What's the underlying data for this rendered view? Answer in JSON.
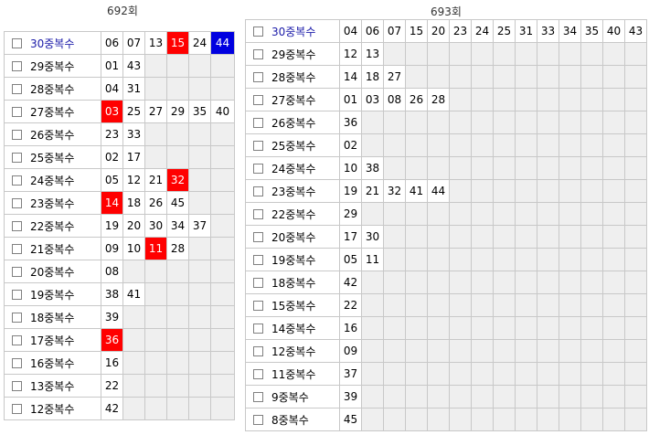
{
  "left": {
    "title": "692회",
    "rows": [
      {
        "label": "30중복수",
        "values": [
          "06",
          "07",
          "13",
          "15",
          "24",
          "44"
        ],
        "hl": true,
        "red": [
          3
        ],
        "blue": [
          5
        ]
      },
      {
        "label": "29중복수",
        "values": [
          "01",
          "43"
        ]
      },
      {
        "label": "28중복수",
        "values": [
          "04",
          "31"
        ]
      },
      {
        "label": "27중복수",
        "values": [
          "03",
          "25",
          "27",
          "29",
          "35",
          "40"
        ],
        "red": [
          0
        ]
      },
      {
        "label": "26중복수",
        "values": [
          "23",
          "33"
        ]
      },
      {
        "label": "25중복수",
        "values": [
          "02",
          "17"
        ]
      },
      {
        "label": "24중복수",
        "values": [
          "05",
          "12",
          "21",
          "32"
        ],
        "red": [
          3
        ]
      },
      {
        "label": "23중복수",
        "values": [
          "14",
          "18",
          "26",
          "45"
        ],
        "red": [
          0
        ]
      },
      {
        "label": "22중복수",
        "values": [
          "19",
          "20",
          "30",
          "34",
          "37"
        ]
      },
      {
        "label": "21중복수",
        "values": [
          "09",
          "10",
          "11",
          "28"
        ],
        "red": [
          2
        ]
      },
      {
        "label": "20중복수",
        "values": [
          "08"
        ]
      },
      {
        "label": "19중복수",
        "values": [
          "38",
          "41"
        ]
      },
      {
        "label": "18중복수",
        "values": [
          "39"
        ]
      },
      {
        "label": "17중복수",
        "values": [
          "36"
        ],
        "red": [
          0
        ]
      },
      {
        "label": "16중복수",
        "values": [
          "16"
        ]
      },
      {
        "label": "13중복수",
        "values": [
          "22"
        ]
      },
      {
        "label": "12중복수",
        "values": [
          "42"
        ]
      }
    ]
  },
  "right": {
    "title": "693회",
    "rows": [
      {
        "label": "30중복수",
        "values": [
          "04",
          "06",
          "07",
          "15",
          "20",
          "23",
          "24",
          "25",
          "31",
          "33",
          "34",
          "35",
          "40",
          "43"
        ],
        "hl": true
      },
      {
        "label": "29중복수",
        "values": [
          "12",
          "13"
        ]
      },
      {
        "label": "28중복수",
        "values": [
          "14",
          "18",
          "27"
        ]
      },
      {
        "label": "27중복수",
        "values": [
          "01",
          "03",
          "08",
          "26",
          "28"
        ]
      },
      {
        "label": "26중복수",
        "values": [
          "36"
        ]
      },
      {
        "label": "25중복수",
        "values": [
          "02"
        ]
      },
      {
        "label": "24중복수",
        "values": [
          "10",
          "38"
        ]
      },
      {
        "label": "23중복수",
        "values": [
          "19",
          "21",
          "32",
          "41",
          "44"
        ]
      },
      {
        "label": "22중복수",
        "values": [
          "29"
        ]
      },
      {
        "label": "20중복수",
        "values": [
          "17",
          "30"
        ]
      },
      {
        "label": "19중복수",
        "values": [
          "05",
          "11"
        ]
      },
      {
        "label": "18중복수",
        "values": [
          "42"
        ]
      },
      {
        "label": "15중복수",
        "values": [
          "22"
        ]
      },
      {
        "label": "14중복수",
        "values": [
          "16"
        ]
      },
      {
        "label": "12중복수",
        "values": [
          "09"
        ]
      },
      {
        "label": "11중복수",
        "values": [
          "37"
        ]
      },
      {
        "label": "9중복수",
        "values": [
          "39"
        ]
      },
      {
        "label": "8중복수",
        "values": [
          "45"
        ]
      }
    ]
  }
}
